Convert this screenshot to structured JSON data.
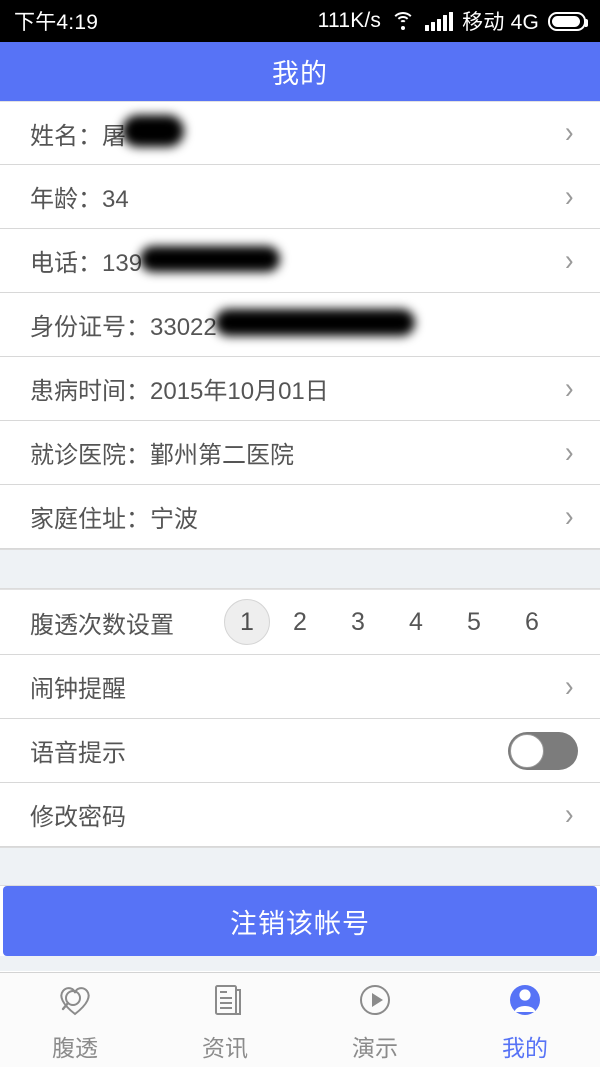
{
  "status_bar": {
    "time": "下午4:19",
    "net_speed": "111K/s",
    "wifi_icon": "wifi-icon",
    "signal_icon": "signal-bars-icon",
    "carrier": "移动 4G",
    "battery_icon": "battery-icon"
  },
  "header": {
    "title": "我的"
  },
  "profile": {
    "rows": [
      {
        "label": "姓名：屠",
        "redacted": "name",
        "chevron": true,
        "name": "row-full-name"
      },
      {
        "label": "年龄：34",
        "redacted": null,
        "chevron": true,
        "name": "row-age"
      },
      {
        "label": "电话：139",
        "redacted": "phone",
        "chevron": true,
        "name": "row-phone"
      },
      {
        "label": "身份证号：33022",
        "redacted": "idno",
        "chevron": false,
        "name": "row-id-number"
      },
      {
        "label": "患病时间：2015年10月01日",
        "redacted": null,
        "chevron": true,
        "name": "row-illness-date"
      },
      {
        "label": "就诊医院：鄞州第二医院",
        "redacted": null,
        "chevron": true,
        "name": "row-hospital"
      },
      {
        "label": "家庭住址：宁波",
        "redacted": null,
        "chevron": true,
        "name": "row-home-address"
      }
    ]
  },
  "settings": {
    "dialysis_count": {
      "label": "腹透次数设置",
      "options": [
        "1",
        "2",
        "3",
        "4",
        "5",
        "6"
      ],
      "selected": "1"
    },
    "alarm": {
      "label": "闹钟提醒",
      "chevron": true
    },
    "voice": {
      "label": "语音提示",
      "toggle_on": false
    },
    "password": {
      "label": "修改密码",
      "chevron": true
    }
  },
  "logout": {
    "label": "注销该帐号"
  },
  "tabbar": {
    "items": [
      {
        "label": "腹透",
        "icon": "heart-search-icon",
        "active": false
      },
      {
        "label": "资讯",
        "icon": "news-document-icon",
        "active": false
      },
      {
        "label": "演示",
        "icon": "play-circle-icon",
        "active": false
      },
      {
        "label": "我的",
        "icon": "user-avatar-icon",
        "active": true
      }
    ]
  },
  "colors": {
    "accent": "#5773f6",
    "text": "#555555",
    "muted": "#8b8b8b",
    "divider": "#d8d8d8",
    "spacer": "#eef2f5",
    "toggle_off": "#7c7c7c"
  }
}
